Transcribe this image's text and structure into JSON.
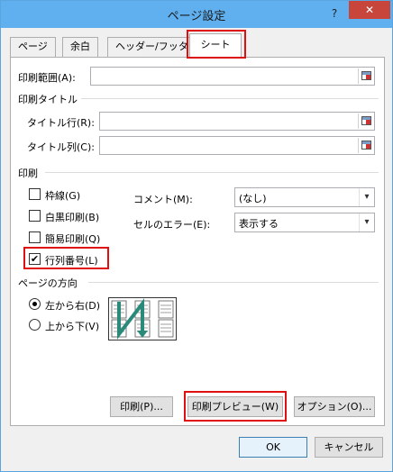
{
  "window": {
    "title": "ページ設定",
    "help": "?",
    "close": "✕"
  },
  "tabs": [
    {
      "label": "ページ"
    },
    {
      "label": "余白"
    },
    {
      "label": "ヘッダー/フッター"
    },
    {
      "label": "シート",
      "active": true
    }
  ],
  "print_area": {
    "label": "印刷範囲(A):",
    "value": ""
  },
  "print_titles": {
    "group": "印刷タイトル",
    "rows_label": "タイトル行(R):",
    "rows_value": "",
    "cols_label": "タイトル列(C):",
    "cols_value": ""
  },
  "print": {
    "group": "印刷",
    "gridlines": {
      "label": "枠線(G)",
      "checked": false
    },
    "black_white": {
      "label": "白黒印刷(B)",
      "checked": false
    },
    "draft": {
      "label": "簡易印刷(Q)",
      "checked": false
    },
    "row_col_headings": {
      "label": "行列番号(L)",
      "checked": true
    },
    "comments_label": "コメント(M):",
    "comments_value": "(なし)",
    "errors_label": "セルのエラー(E):",
    "errors_value": "表示する",
    "check_mark": "✔",
    "dropdown_arrow": "▾"
  },
  "page_order": {
    "group": "ページの方向",
    "down_then_over": {
      "label": "左から右(D)",
      "selected": true
    },
    "over_then_down": {
      "label": "上から下(V)",
      "selected": false
    }
  },
  "buttons": {
    "print": "印刷(P)...",
    "print_preview": "印刷プレビュー(W)",
    "options": "オプション(O)...",
    "ok": "OK",
    "cancel": "キャンセル"
  },
  "colors": {
    "titlebar": "#60b0f0",
    "close": "#c7453a",
    "highlight": "#e01010",
    "arrow": "#2a8a7a"
  }
}
